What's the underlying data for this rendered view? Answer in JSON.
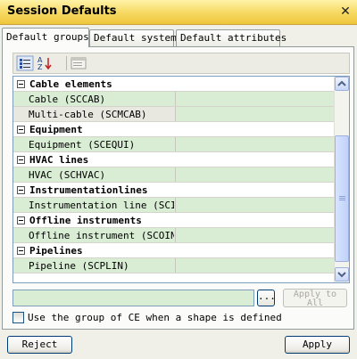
{
  "window": {
    "title": "Session Defaults",
    "close_icon": "close-icon"
  },
  "tabs": [
    {
      "label": "Default groups",
      "active": true
    },
    {
      "label": "Default system",
      "active": false
    },
    {
      "label": "Default attributes",
      "active": false
    }
  ],
  "toolbar": {
    "buttons": [
      "categorized-view-icon",
      "sort-alphabetical-icon",
      "property-pages-icon"
    ]
  },
  "groups": [
    {
      "label": "Cable elements",
      "items": [
        "Cable (SCCAB)",
        "Multi-cable (SCMCAB)"
      ]
    },
    {
      "label": "Equipment",
      "items": [
        "Equipment (SCEQUI)"
      ]
    },
    {
      "label": "HVAC lines",
      "items": [
        "HVAC (SCHVAC)"
      ]
    },
    {
      "label": "Instrumentationlines",
      "items": [
        "Instrumentation line (SCILI"
      ]
    },
    {
      "label": "Offline instruments",
      "items": [
        "Offline instrument (SCOINS)"
      ]
    },
    {
      "label": "Pipelines",
      "items": [
        "Pipeline (SCPLIN)"
      ]
    }
  ],
  "value_field": {
    "value": "",
    "browse_label": "..."
  },
  "apply_to_all": {
    "line1": "Apply to",
    "line2": "All"
  },
  "checkbox": {
    "label": "Use the group of CE when a shape is defined",
    "checked": false
  },
  "buttons": {
    "reject": "Reject",
    "apply": "Apply"
  },
  "colors": {
    "titlebar": "#f6d860",
    "item_background": "#d8edd4",
    "border": "#7f9db9"
  }
}
